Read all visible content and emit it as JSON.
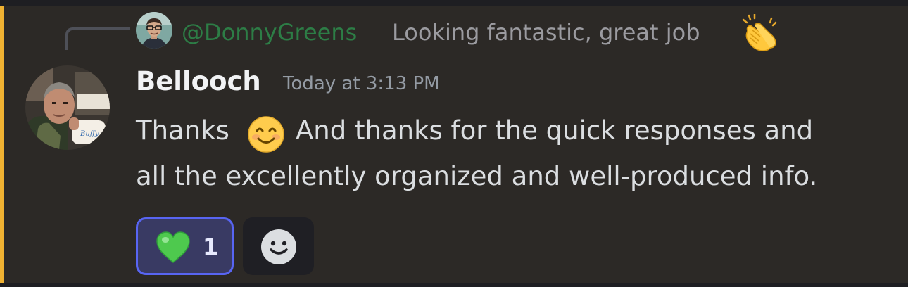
{
  "reply": {
    "author": "@DonnyGreens",
    "text": "Looking fantastic, great job",
    "emoji": "clapping-hands"
  },
  "message": {
    "username": "Bellooch",
    "timestamp": "Today at 3:13 PM",
    "line1_start": "Thanks",
    "inline_emoji": "smiling-face",
    "line1_rest": "And thanks for the quick responses and",
    "line2": "all the excellently organized and well-produced info."
  },
  "reactions": [
    {
      "emoji": "green-heart",
      "count": "1",
      "active": true
    }
  ],
  "add_reaction_icon": "smile-add-icon",
  "colors": {
    "mention_highlight": "#f0b232",
    "reply_author": "#2d7d46",
    "reaction_active_border": "#5865f2",
    "background": "#2c2926"
  }
}
